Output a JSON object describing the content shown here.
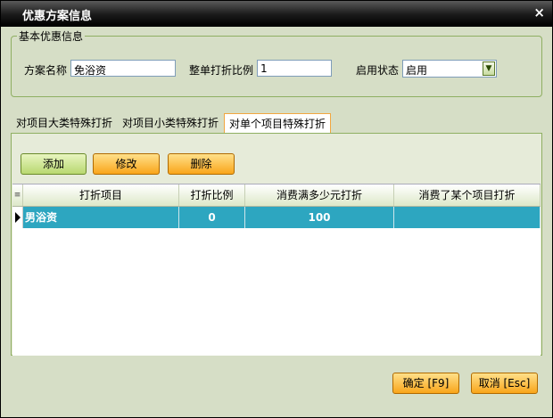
{
  "window": {
    "title": "优惠方案信息",
    "close_label": "×"
  },
  "basic": {
    "group_title": "基本优惠信息",
    "name_label": "方案名称",
    "name_value": "免浴资",
    "ratio_label": "整单打折比例",
    "ratio_value": "1",
    "status_label": "启用状态",
    "status_value": "启用"
  },
  "tabs": [
    {
      "label": "对项目大类特殊打折"
    },
    {
      "label": "对项目小类特殊打折"
    },
    {
      "label": "对单个项目特殊打折"
    }
  ],
  "toolbar": {
    "add_label": "添加",
    "edit_label": "修改",
    "delete_label": "删除"
  },
  "table": {
    "corner": "≡",
    "headers": [
      "打折项目",
      "打折比例",
      "消费满多少元打折",
      "消费了某个项目打折"
    ],
    "rows": [
      {
        "item": "男浴资",
        "ratio": "0",
        "min_spend": "100",
        "item_spend": ""
      }
    ]
  },
  "footer": {
    "ok_label": "确定 [F9]",
    "cancel_label": "取消 [Esc]"
  },
  "colors": {
    "accent": "#f9a51a",
    "selected_row": "#2da6c0",
    "frame_green": "#8faf62"
  }
}
